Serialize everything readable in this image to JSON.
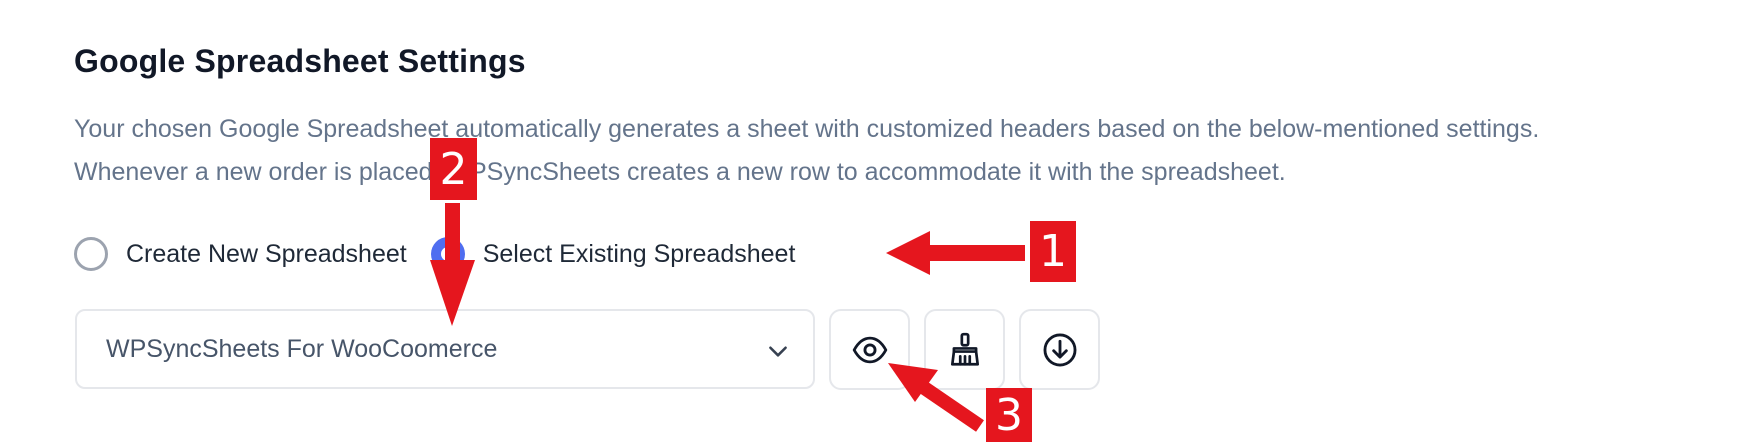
{
  "section": {
    "title": "Google Spreadsheet Settings",
    "description": "Your chosen Google Spreadsheet automatically generates a sheet with customized headers based on the below-mentioned settings. Whenever a new order is placed, WPSyncSheets creates a new row to accommodate it with the spreadsheet."
  },
  "radios": {
    "create_new": {
      "label": "Create New Spreadsheet",
      "checked": false
    },
    "select_existing": {
      "label": "Select Existing Spreadsheet",
      "checked": true
    }
  },
  "spreadsheet_select": {
    "value": "WPSyncSheets For WooCoomerce"
  },
  "actions": {
    "view_icon": "eye-icon",
    "clear_icon": "broom-icon",
    "download_icon": "download-icon"
  },
  "annotations": {
    "badge_1": "1",
    "badge_2": "2",
    "badge_3": "3",
    "color": "#e5161e"
  },
  "colors": {
    "accent": "#4f6ef0",
    "title": "#111827",
    "description": "#64748b"
  }
}
